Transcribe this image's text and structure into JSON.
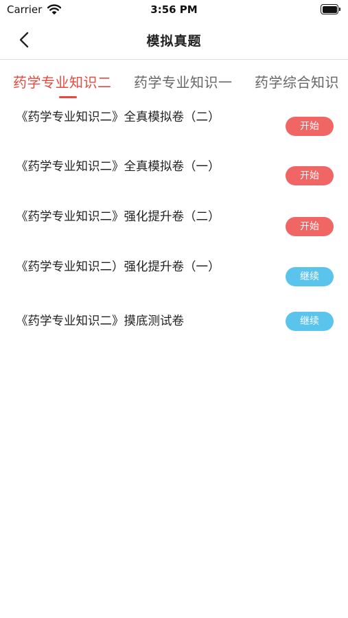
{
  "status_bar": {
    "carrier": "Carrier",
    "time": "3:56 PM"
  },
  "nav": {
    "title": "模拟真题",
    "back_icon": "chevron-left-icon"
  },
  "tabs": [
    {
      "label": "药学专业知识二",
      "active": true
    },
    {
      "label": "药学专业知识一",
      "active": false
    },
    {
      "label": "药学综合知识",
      "active": false
    }
  ],
  "colors": {
    "accent_red": "#e8493d",
    "start_button": "#f06665",
    "continue_button": "#5bc4ec"
  },
  "exams": [
    {
      "title": "《药学专业知识二》全真模拟卷（二）",
      "action": "开始",
      "state": "start"
    },
    {
      "title": "《药学专业知识二》全真模拟卷（一）",
      "action": "开始",
      "state": "start"
    },
    {
      "title": "《药学专业知识二》强化提升卷（二）",
      "action": "开始",
      "state": "start"
    },
    {
      "title": "《药学专业知识二）强化提升卷（一）",
      "action": "继续",
      "state": "continue"
    },
    {
      "title": "《药学专业知识二》摸底测试卷",
      "action": "继续",
      "state": "continue"
    }
  ]
}
